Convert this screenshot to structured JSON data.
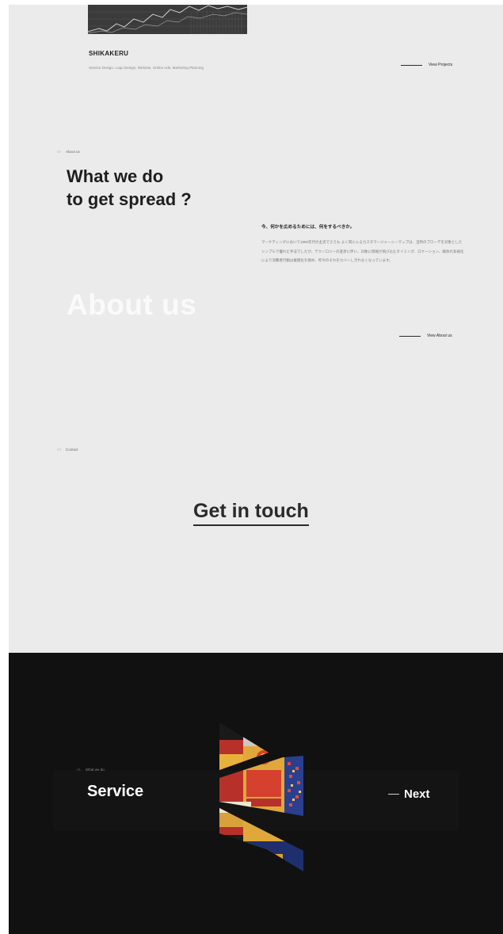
{
  "project": {
    "title": "SHIKAKERU",
    "tags": "Service Design, Logo Design, Website, Online Ads, Marketing Planning",
    "view_projects": "View Projects"
  },
  "about": {
    "num": "02",
    "label": "About us",
    "heading_line1": "What we do",
    "heading_line2": "to get spread ?",
    "jp_title": "今、何かを広めるためには、何をするべきか。",
    "jp_body": "マーケティングにおいて1990年代の主流でさえも よく耳に入るカスタマージャーニーマップは、当時のブローデを対象としたシンプルで優れた手法でしたが、テクノロジーの進歩に伴い、対象に情報が飛び込むタイミング、ロケーション、媒体の多様化により消費者行動は複雑化を極め、昨今のそれをカバーしきれなくなっています。",
    "watermark": "About us",
    "view_about": "View About us"
  },
  "contact": {
    "num": "03",
    "label": "Contact",
    "cta": "Get in touch"
  },
  "service": {
    "num": "01",
    "label": "What we do",
    "title": "Service",
    "next": "Next"
  }
}
